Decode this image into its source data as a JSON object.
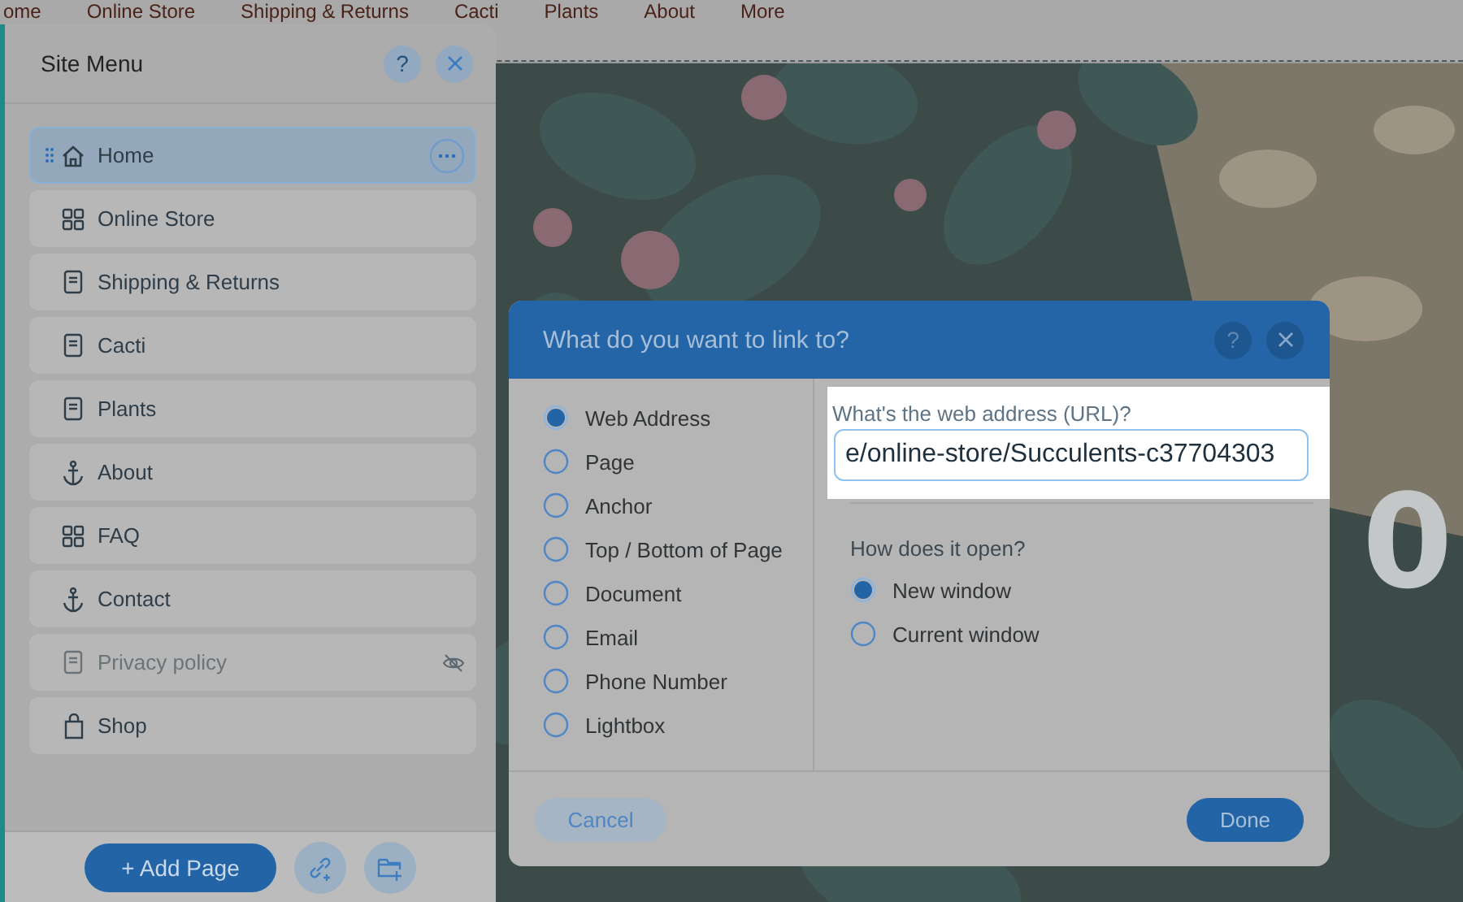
{
  "top_nav": {
    "items": [
      "ome",
      "Online Store",
      "Shipping & Returns",
      "Cacti",
      "Plants",
      "About",
      "More"
    ]
  },
  "hero": {
    "kind": "picture",
    "text": "0"
  },
  "site_menu": {
    "title": "Site Menu",
    "help": "?",
    "items": [
      {
        "label": "Home",
        "kind": "home",
        "selected": true,
        "hidden": false
      },
      {
        "label": "Online Store",
        "kind": "store",
        "selected": false,
        "hidden": false
      },
      {
        "label": "Shipping & Returns",
        "kind": "page",
        "selected": false,
        "hidden": false
      },
      {
        "label": "Cacti",
        "kind": "page",
        "selected": false,
        "hidden": false
      },
      {
        "label": "Plants",
        "kind": "page",
        "selected": false,
        "hidden": false
      },
      {
        "label": "About",
        "kind": "anchor",
        "selected": false,
        "hidden": false
      },
      {
        "label": "FAQ",
        "kind": "store",
        "selected": false,
        "hidden": false
      },
      {
        "label": "Contact",
        "kind": "anchor",
        "selected": false,
        "hidden": false
      },
      {
        "label": "Privacy policy",
        "kind": "page",
        "selected": false,
        "hidden": true
      },
      {
        "label": "Shop",
        "kind": "bag",
        "selected": false,
        "hidden": false
      }
    ],
    "add_button": "+ Add Page"
  },
  "dialog": {
    "title": "What do you want to link to?",
    "help": "?",
    "link_types": [
      {
        "label": "Web Address",
        "selected": true
      },
      {
        "label": "Page",
        "selected": false
      },
      {
        "label": "Anchor",
        "selected": false
      },
      {
        "label": "Top / Bottom of Page",
        "selected": false
      },
      {
        "label": "Document",
        "selected": false
      },
      {
        "label": "Email",
        "selected": false
      },
      {
        "label": "Phone Number",
        "selected": false
      },
      {
        "label": "Lightbox",
        "selected": false
      }
    ],
    "url_label": "What's the web address (URL)?",
    "url_value": "e/online-store/Succulents-c37704303",
    "open_label": "How does it open?",
    "open_options": [
      {
        "label": "New window",
        "selected": true
      },
      {
        "label": "Current window",
        "selected": false
      }
    ],
    "cancel": "Cancel",
    "done": "Done"
  }
}
